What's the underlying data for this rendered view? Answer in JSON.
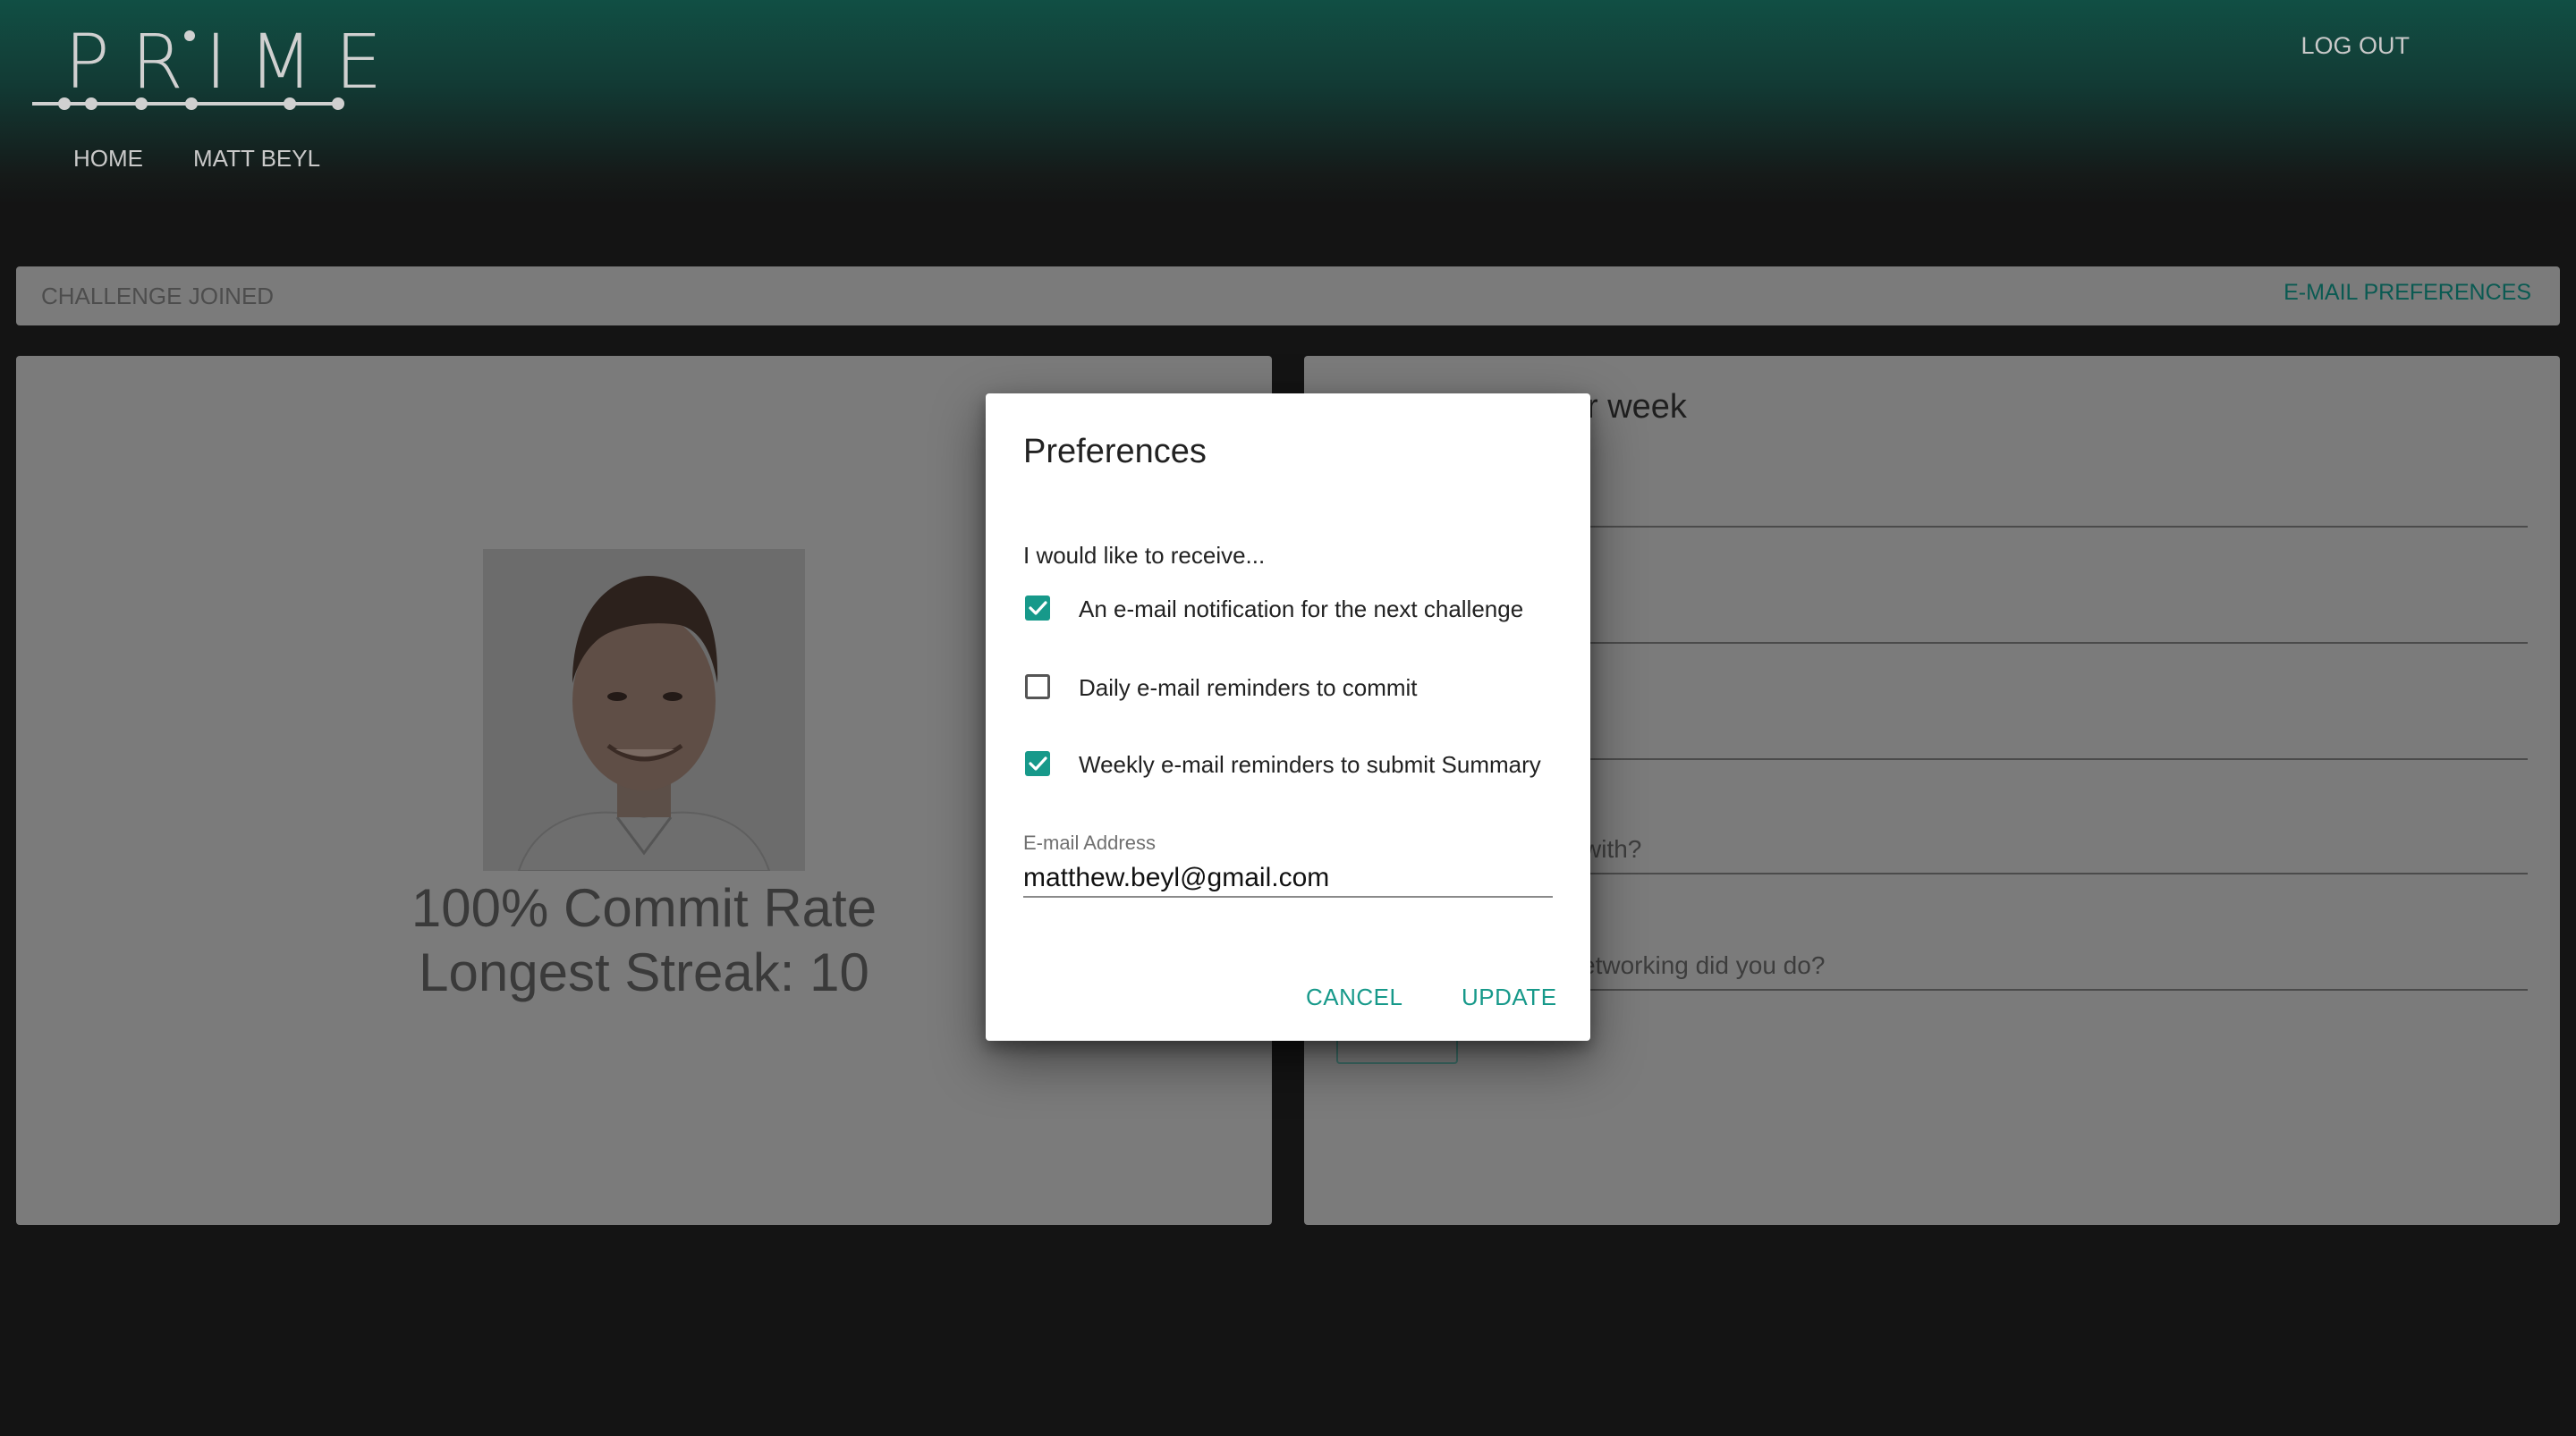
{
  "header": {
    "logo_text": "PRIME",
    "logout_label": "LOG OUT",
    "nav": [
      {
        "label": "HOME"
      },
      {
        "label": "MATT BEYL"
      }
    ]
  },
  "subbar": {
    "status_label": "CHALLENGE JOINED",
    "email_prefs_link": "E-MAIL PREFERENCES"
  },
  "profile": {
    "commit_rate": "100% Commit Rate",
    "longest_streak": "Longest Streak: 10"
  },
  "summary_card": {
    "title_visible": "r week",
    "partial_labels": [
      " with?",
      "etworking did you do?"
    ]
  },
  "dialog": {
    "title": "Preferences",
    "intro": "I would like to receive...",
    "options": [
      {
        "label": "An e-mail notification for the next challenge",
        "checked": true
      },
      {
        "label": "Daily e-mail reminders to commit",
        "checked": false
      },
      {
        "label": "Weekly e-mail reminders to submit Summary",
        "checked": true
      }
    ],
    "email_label": "E-mail Address",
    "email_value": "matthew.beyl@gmail.com",
    "cancel_label": "CANCEL",
    "update_label": "UPDATE"
  },
  "colors": {
    "accent": "#17998a",
    "header_top": "#114f44",
    "backdrop": "#7b7b7b",
    "page_bg": "#141414"
  }
}
